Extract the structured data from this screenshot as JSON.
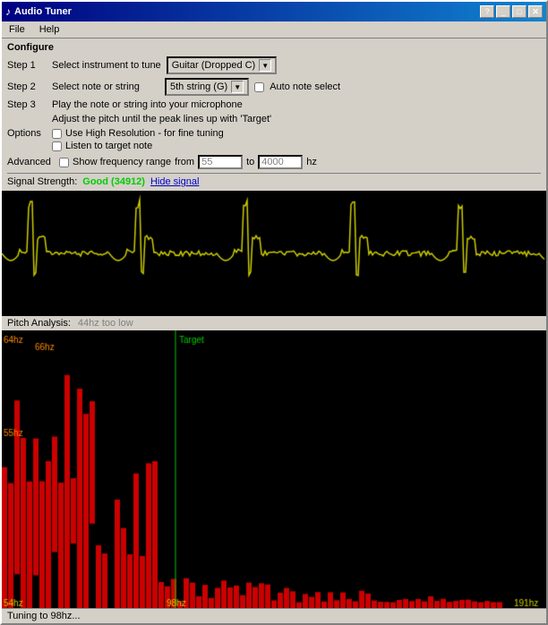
{
  "window": {
    "title": "Audio Tuner",
    "icon": "♪"
  },
  "title_buttons": [
    "?",
    "_",
    "□",
    "✕"
  ],
  "menu": {
    "items": [
      "File",
      "Help"
    ]
  },
  "configure": {
    "label": "Configure"
  },
  "steps": [
    {
      "label": "Step 1",
      "desc": "Select instrument to tune",
      "control": "dropdown",
      "value": "Guitar (Dropped C)",
      "extra": null
    },
    {
      "label": "Step 2",
      "desc": "Select note or string",
      "control": "dropdown",
      "value": "5th string (G)",
      "extra": "Auto note select"
    },
    {
      "label": "Step 3",
      "desc": "Play the note or string into your microphone",
      "desc2": "Adjust the pitch until the peak lines up with 'Target'",
      "control": null
    }
  ],
  "options": {
    "label": "Options",
    "items": [
      "Use High Resolution - for fine tuning",
      "Listen to target note"
    ]
  },
  "advanced": {
    "label": "Advanced",
    "checkbox_label": "Show frequency range",
    "from_label": "from",
    "from_value": "55",
    "to_label": "to",
    "to_value": "4000",
    "unit": "hz"
  },
  "signal": {
    "label": "Signal Strength:",
    "status": "Good (34912)",
    "hide_label": "Hide signal"
  },
  "pitch_analysis": {
    "label": "Pitch Analysis:",
    "status": "44hz too low"
  },
  "status_bar": {
    "text": "Tuning to 98hz..."
  },
  "chart": {
    "labels": {
      "left_top": "64hz",
      "left_mid": "66hz",
      "left_low": "55hz",
      "target": "Target",
      "bottom_left": "54hz",
      "bottom_mid": "98hz",
      "bottom_right": "191hz"
    }
  }
}
